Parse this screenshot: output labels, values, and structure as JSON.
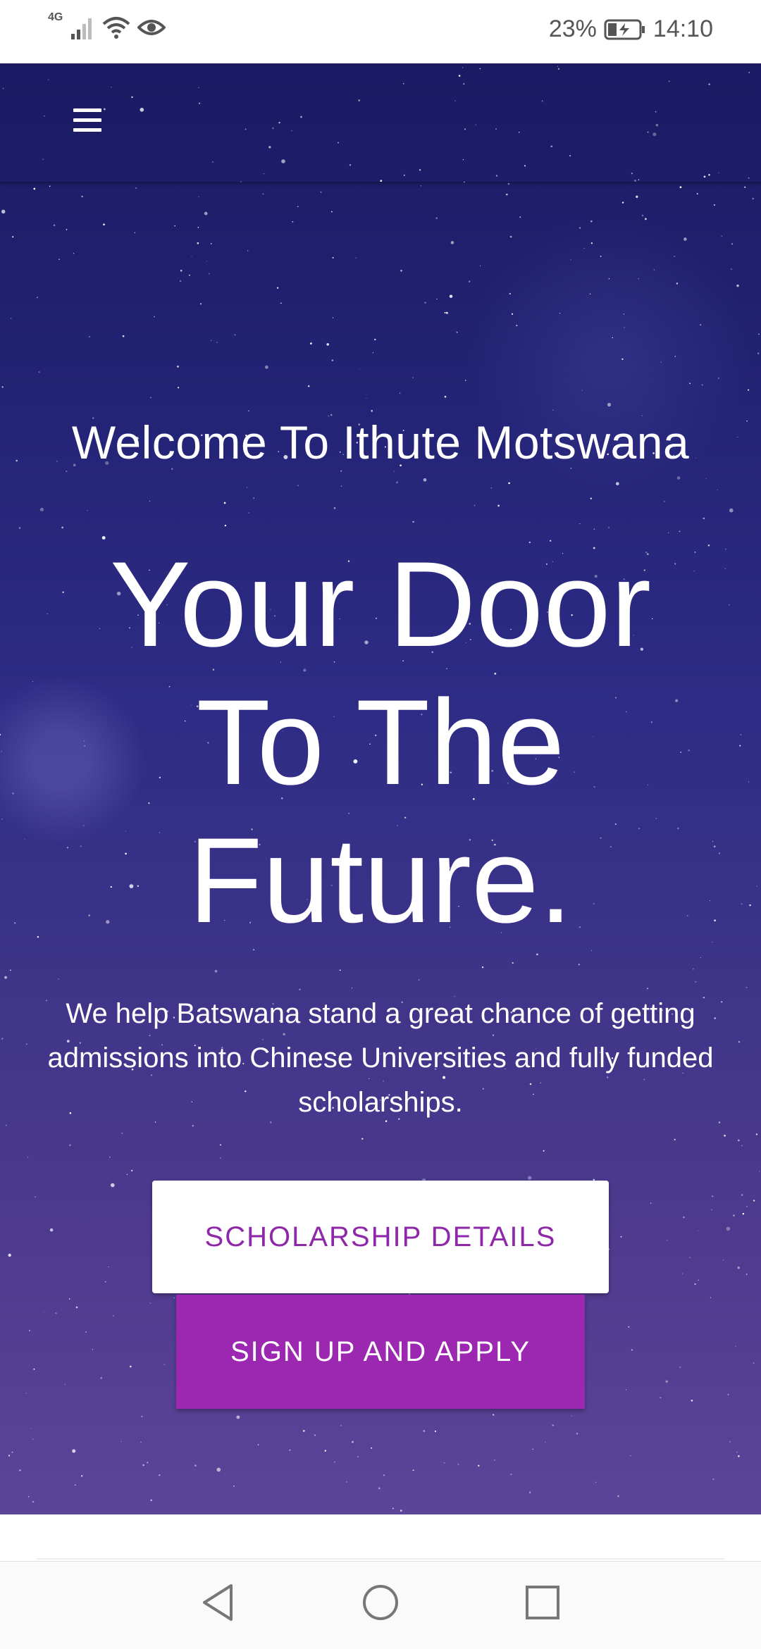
{
  "status_bar": {
    "network": "4G",
    "battery_percent": "23%",
    "time": "14:10",
    "icons": [
      "signal-icon",
      "wifi-icon",
      "eye-icon",
      "battery-charging-icon"
    ]
  },
  "hero": {
    "welcome": "Welcome To Ithute Motswana",
    "headline_lines": [
      "Your Door",
      "To The",
      "Future."
    ],
    "tagline": "We help Batswana stand a great chance of getting admissions into Chinese Universities and fully funded scholarships.",
    "primary_button": "SCHOLARSHIP DETAILS",
    "secondary_button": "SIGN UP AND APPLY"
  },
  "nav": {
    "menu_icon": "hamburger-menu-icon"
  },
  "system_nav": {
    "icons": [
      "back-icon",
      "home-icon",
      "recents-icon"
    ]
  },
  "colors": {
    "accent": "#9c27b0",
    "accent_text": "#8e28a8",
    "hero_top": "#1b1a63",
    "hero_bottom": "#5b4598"
  }
}
